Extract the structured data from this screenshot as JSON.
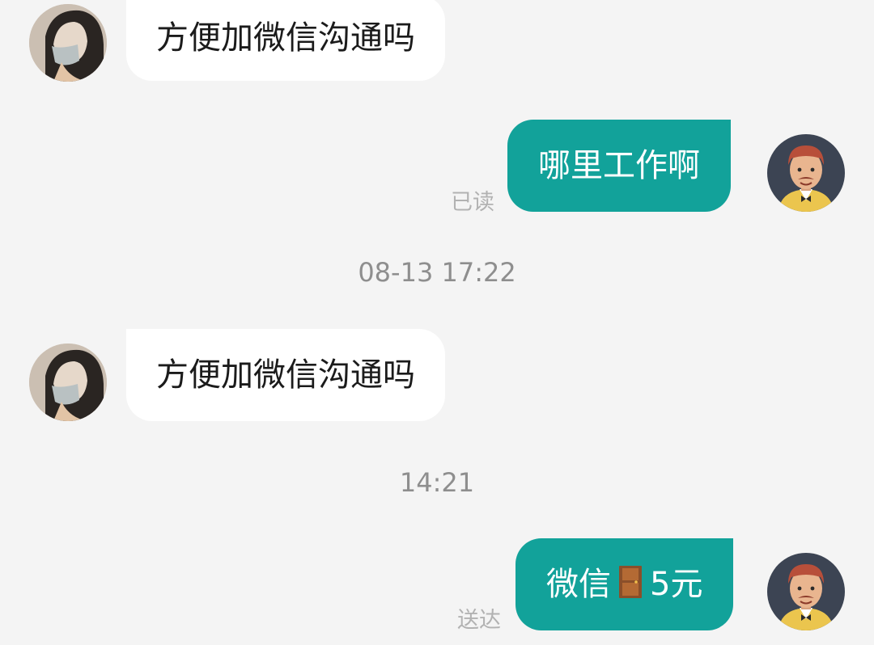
{
  "messages": [
    {
      "side": "in",
      "text": "方便加微信沟通吗"
    },
    {
      "side": "out",
      "text": "哪里工作啊",
      "status": "已读"
    },
    {
      "side": "in",
      "text": "方便加微信沟通吗"
    },
    {
      "side": "out",
      "text_before": "微信",
      "text_after": "5元",
      "icon": "door-icon",
      "status": "送达"
    }
  ],
  "timestamps": [
    "08-13 17:22",
    "14:21"
  ],
  "colors": {
    "background": "#f4f4f4",
    "incoming_bubble": "#ffffff",
    "outgoing_bubble": "#12a29a",
    "status_text": "#b2b2b2",
    "timestamp_text": "#8e8e8e"
  }
}
